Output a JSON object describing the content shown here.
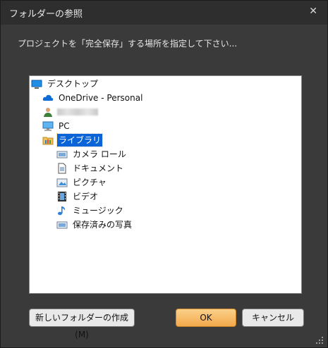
{
  "dialog": {
    "title": "フォルダーの参照",
    "instruction": "プロジェクトを「完全保存」する場所を指定して下さい..."
  },
  "tree": {
    "items": [
      {
        "label": "デスクトップ",
        "icon": "desktop-icon"
      },
      {
        "label": "OneDrive - Personal",
        "icon": "cloud-icon"
      },
      {
        "label": "",
        "icon": "user-icon"
      },
      {
        "label": "PC",
        "icon": "computer-icon"
      },
      {
        "label": "ライブラリ",
        "icon": "library-icon",
        "selected": true
      },
      {
        "label": "カメラ ロール",
        "icon": "camera-roll-icon"
      },
      {
        "label": "ドキュメント",
        "icon": "documents-icon"
      },
      {
        "label": "ピクチャ",
        "icon": "pictures-icon"
      },
      {
        "label": "ビデオ",
        "icon": "videos-icon"
      },
      {
        "label": "ミュージック",
        "icon": "music-icon"
      },
      {
        "label": "保存済みの写真",
        "icon": "saved-pictures-icon"
      }
    ]
  },
  "buttons": {
    "new_folder": "新しいフォルダーの作成(M)",
    "ok": "OK",
    "cancel": "キャンセル"
  },
  "colors": {
    "selection": "#0a64d8",
    "ok_button": "#f3a94b"
  }
}
